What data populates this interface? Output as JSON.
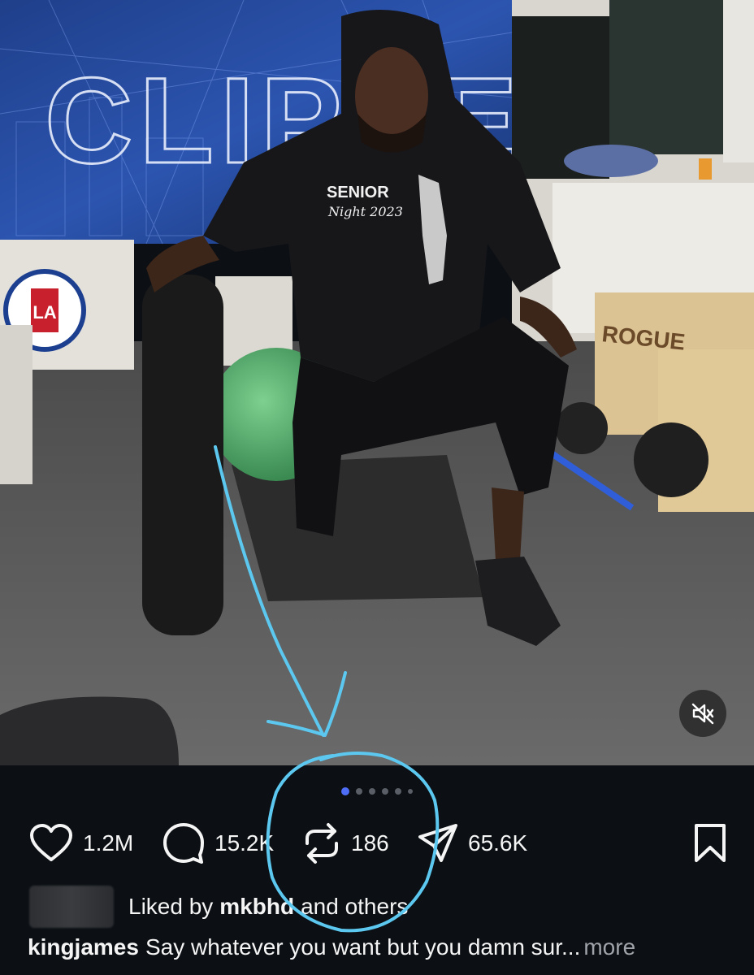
{
  "photo": {
    "banner_text": "CLIPPERS",
    "hoodie_text_1": "SENIOR",
    "hoodie_text_2": "Night 2023",
    "box_brand": "ROGUE",
    "la_logo_text": "LA",
    "mute_icon": "speaker-muted-icon"
  },
  "carousel": {
    "total": 6,
    "active_index": 0
  },
  "actions": {
    "like_count": "1.2M",
    "comment_count": "15.2K",
    "repost_count": "186",
    "share_count": "65.6K"
  },
  "liked_by": {
    "prefix": "Liked by",
    "user": "mkbhd",
    "suffix": "and others"
  },
  "caption": {
    "username": "kingjames",
    "text": "Say whatever you want but you damn sur...",
    "more": "more"
  },
  "colors": {
    "background": "#0c1014",
    "annotation": "#5cc8f0",
    "active_dot": "#4f6ef7"
  }
}
